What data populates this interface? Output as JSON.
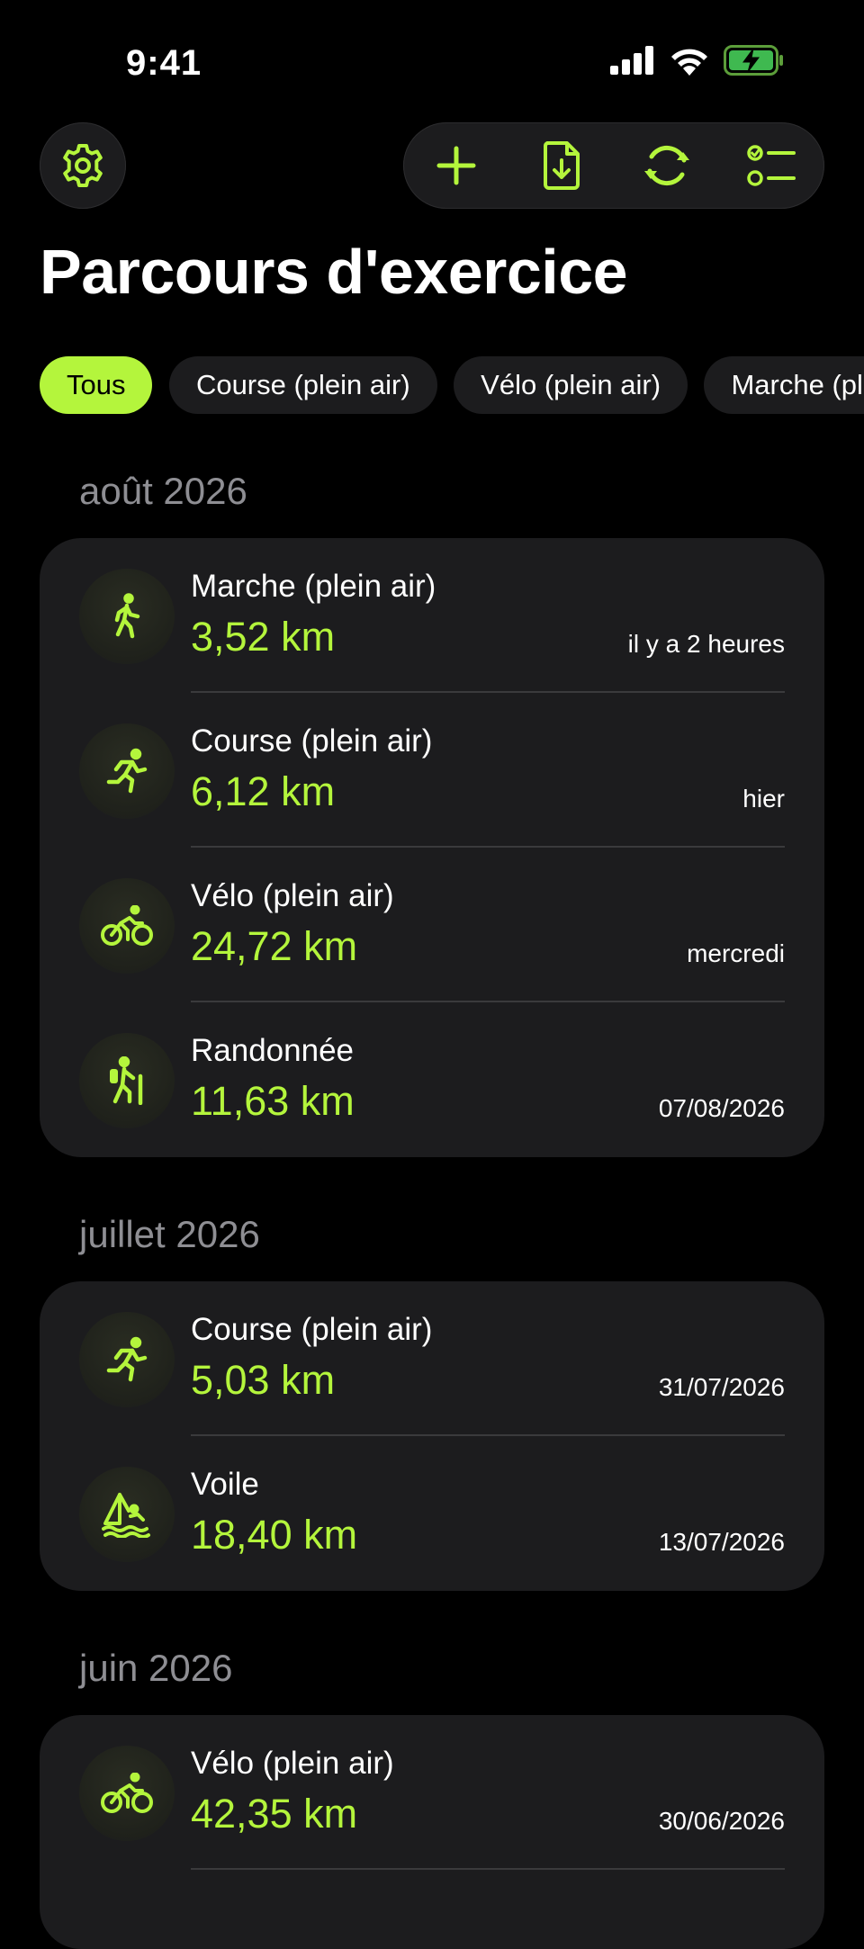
{
  "status_bar": {
    "time": "9:41"
  },
  "page_title": "Parcours d'exercice",
  "filters": [
    {
      "label": "Tous",
      "active": true
    },
    {
      "label": "Course (plein air)",
      "active": false
    },
    {
      "label": "Vélo (plein air)",
      "active": false
    },
    {
      "label": "Marche (plein air)",
      "active": false
    }
  ],
  "sections": [
    {
      "title": "août 2026",
      "items": [
        {
          "icon": "walk-icon",
          "name": "Marche (plein air)",
          "distance": "3,52 km",
          "date": "il y a 2 heures"
        },
        {
          "icon": "run-icon",
          "name": "Course (plein air)",
          "distance": "6,12 km",
          "date": "hier"
        },
        {
          "icon": "bike-icon",
          "name": "Vélo (plein air)",
          "distance": "24,72 km",
          "date": "mercredi"
        },
        {
          "icon": "hike-icon",
          "name": "Randonnée",
          "distance": "11,63 km",
          "date": "07/08/2026"
        }
      ]
    },
    {
      "title": "juillet 2026",
      "items": [
        {
          "icon": "run-icon",
          "name": "Course (plein air)",
          "distance": "5,03 km",
          "date": "31/07/2026"
        },
        {
          "icon": "sail-icon",
          "name": "Voile",
          "distance": "18,40 km",
          "date": "13/07/2026"
        }
      ]
    },
    {
      "title": "juin 2026",
      "items": [
        {
          "icon": "bike-icon",
          "name": "Vélo (plein air)",
          "distance": "42,35 km",
          "date": "30/06/2026"
        }
      ]
    }
  ],
  "colors": {
    "accent": "#b4f53c",
    "card": "#1c1c1e",
    "background": "#000000",
    "muted": "#8e8e93"
  }
}
